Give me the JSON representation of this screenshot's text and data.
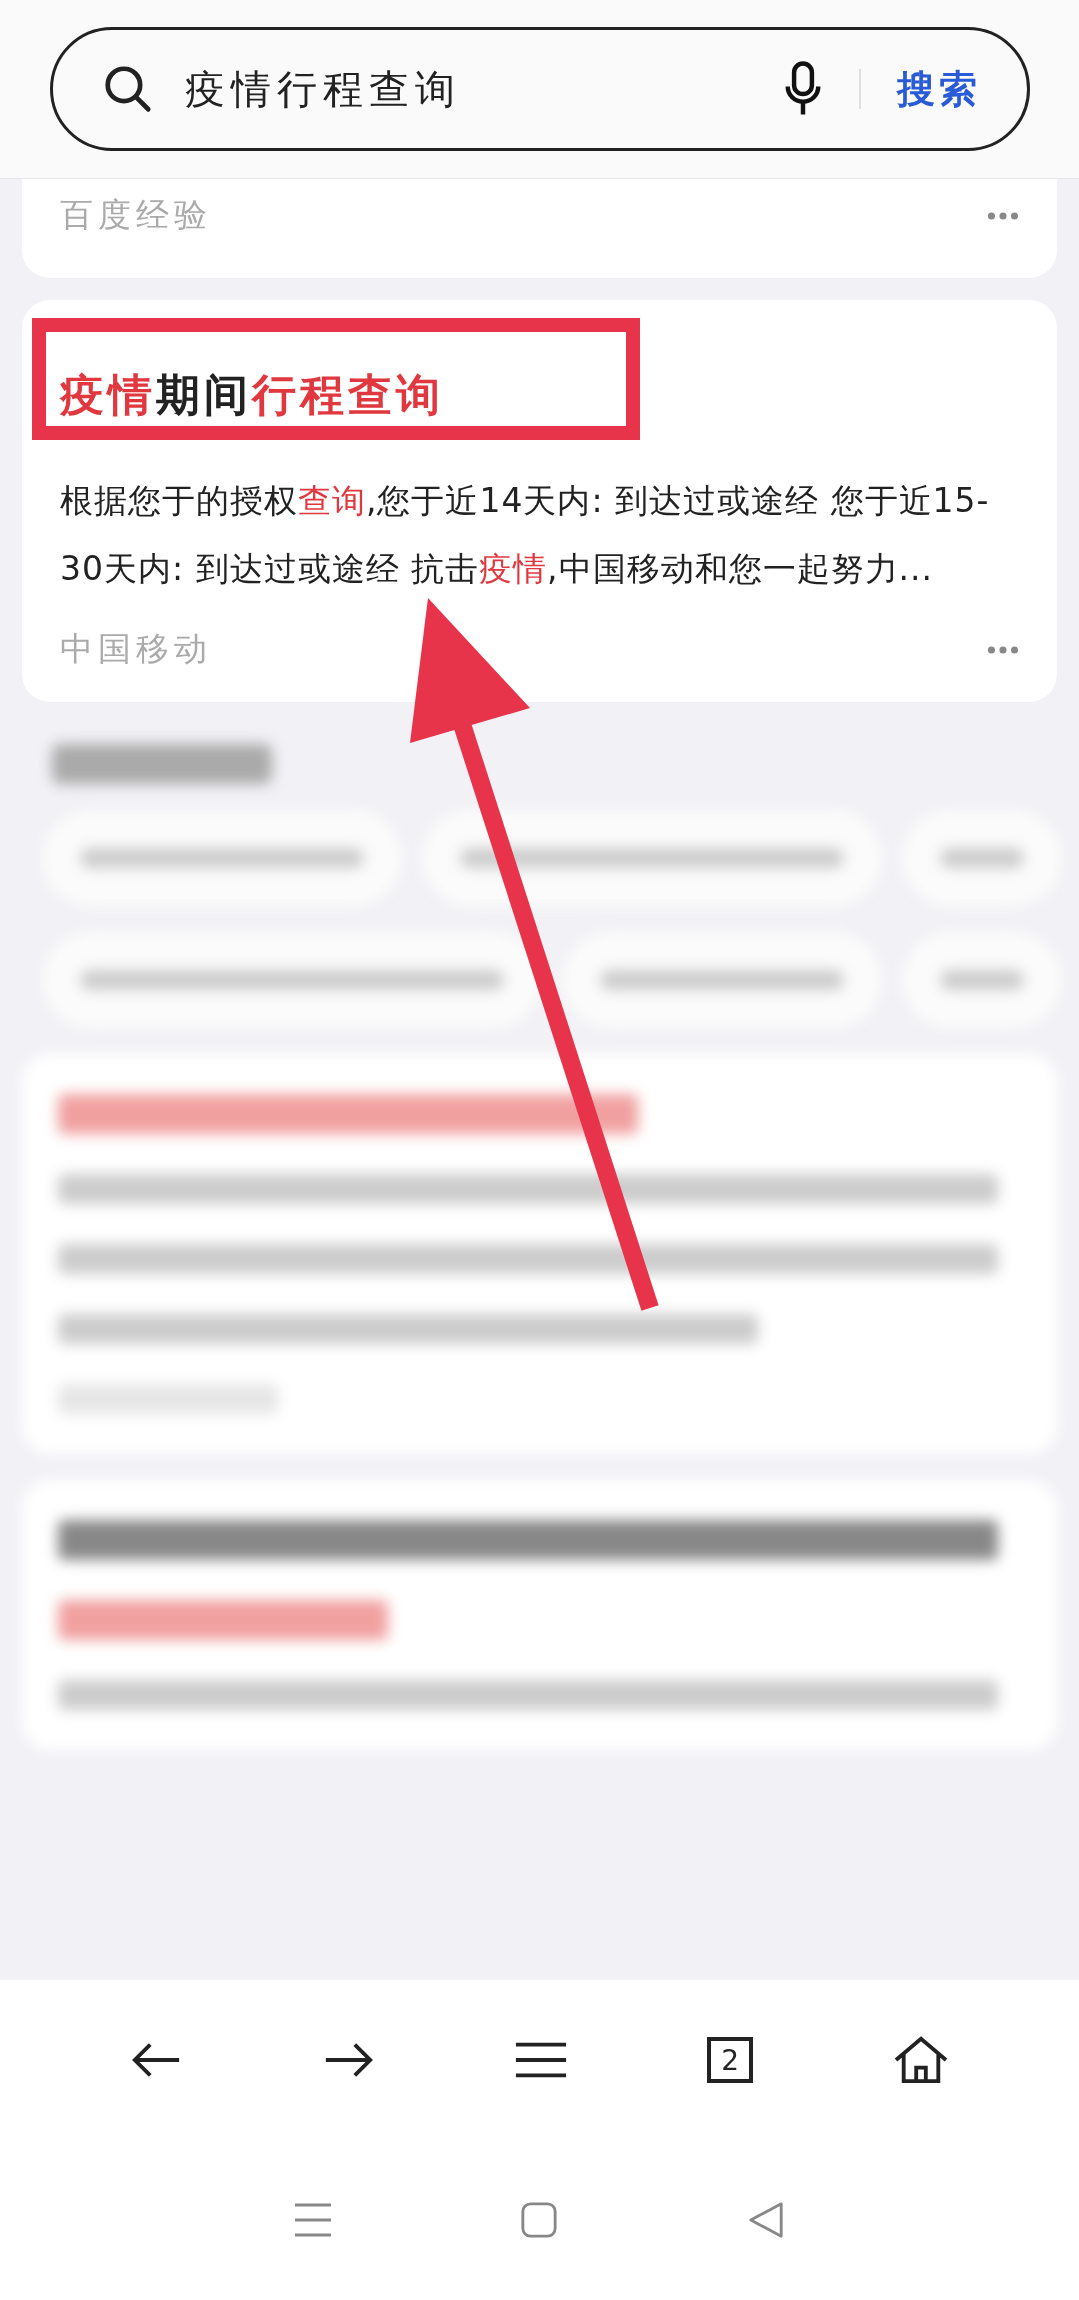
{
  "search": {
    "query": "疫情行程查询",
    "button": "搜索"
  },
  "results": [
    {
      "source": "百度经验",
      "partial": true
    },
    {
      "title": [
        {
          "text": "疫情",
          "highlight": true
        },
        {
          "text": "期间",
          "highlight": false
        },
        {
          "text": "行程查询",
          "highlight": true
        }
      ],
      "snippet": [
        {
          "text": "根据您于的授权",
          "highlight": false
        },
        {
          "text": "查询",
          "highlight": true
        },
        {
          "text": ",您于近14天内: 到达过或途经 您于近15-30天内: 到达过或途经 抗击",
          "highlight": false
        },
        {
          "text": "疫情",
          "highlight": true
        },
        {
          "text": ",中国移动和您一起努力...",
          "highlight": false
        }
      ],
      "source": "中国移动",
      "partial": false
    }
  ],
  "toolbar": {
    "tab_count": "2"
  }
}
